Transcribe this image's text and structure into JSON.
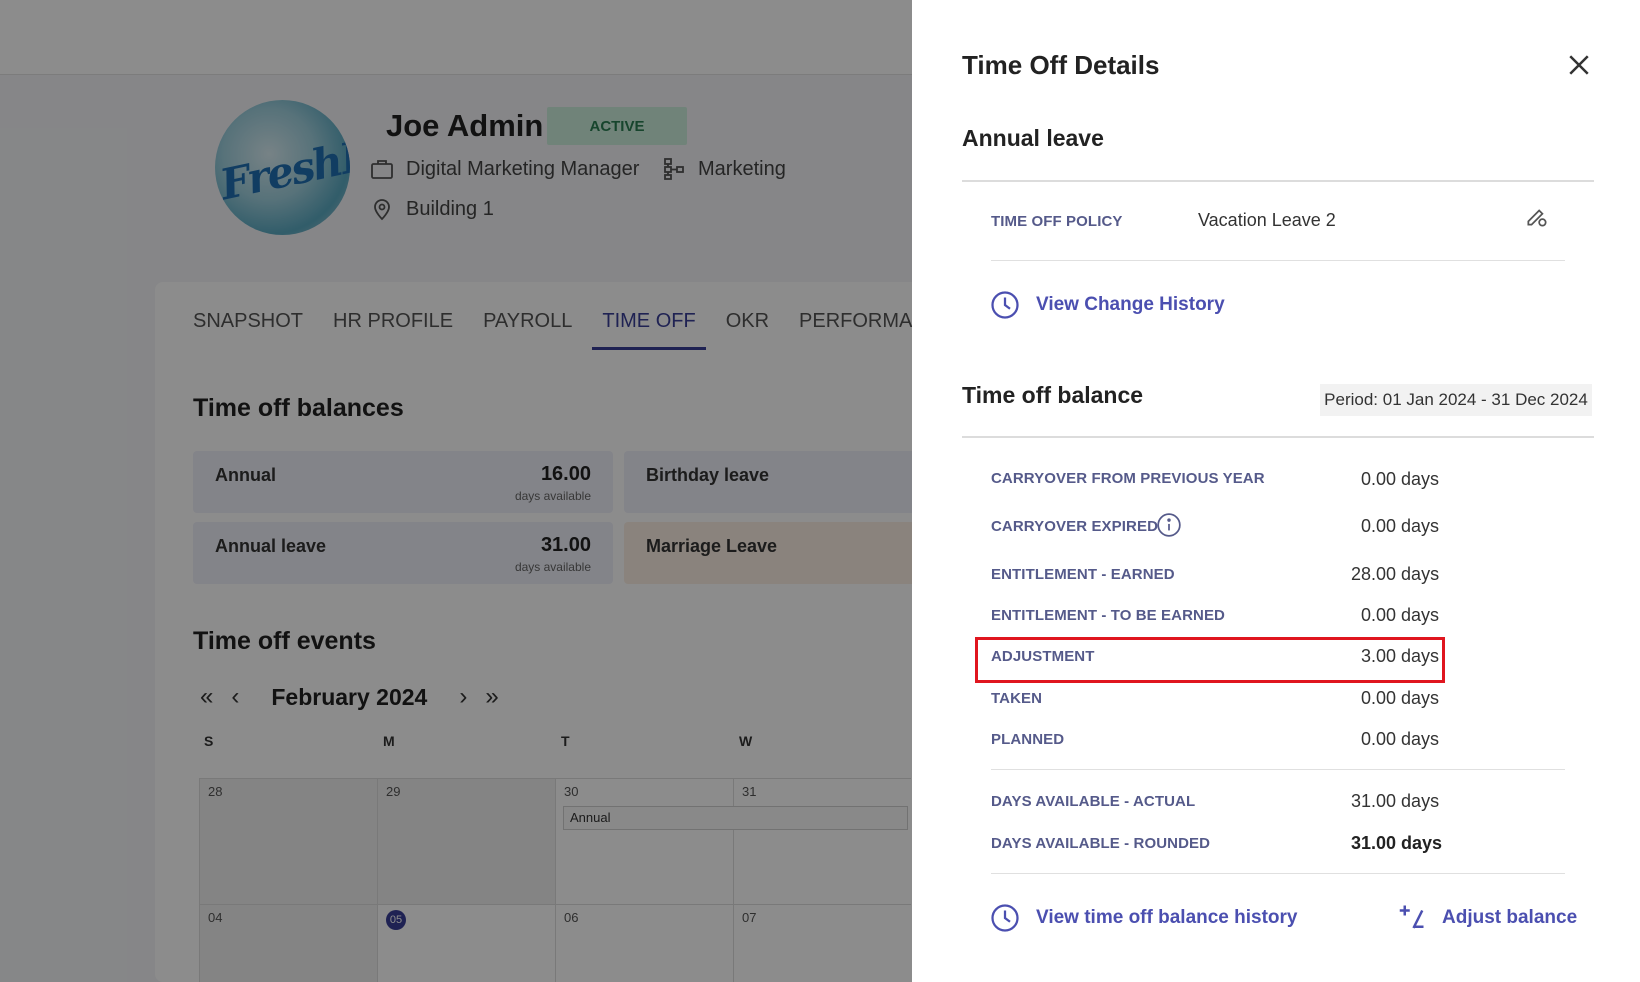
{
  "background": {
    "employee": {
      "name": "Joe Admin",
      "status": "ACTIVE",
      "job_title": "Digital Marketing Manager",
      "department": "Marketing",
      "location": "Building 1",
      "avatar_logo_text": "FreshBo"
    },
    "tabs": [
      "SNAPSHOT",
      "HR PROFILE",
      "PAYROLL",
      "TIME OFF",
      "OKR",
      "PERFORMANC"
    ],
    "active_tab": "TIME OFF",
    "balances_title": "Time off balances",
    "balances": [
      {
        "label": "Annual",
        "value": "16.00",
        "unit": "days available"
      },
      {
        "label": "Birthday leave"
      },
      {
        "label": "Annual leave",
        "value": "31.00",
        "unit": "days available"
      },
      {
        "label": "Marriage Leave"
      }
    ],
    "events_title": "Time off events",
    "calendar": {
      "month": "February 2024",
      "weekdays": [
        "S",
        "M",
        "T",
        "W"
      ],
      "row1": [
        "28",
        "29",
        "30",
        "31"
      ],
      "row2": [
        "04",
        "05",
        "06",
        "07"
      ],
      "event_label": "Annual"
    }
  },
  "panel": {
    "title": "Time Off Details",
    "leave_name": "Annual leave",
    "policy": {
      "label": "TIME OFF POLICY",
      "value": "Vacation Leave 2"
    },
    "view_change_history": "View Change History",
    "balance_title": "Time off balance",
    "period": "Period: 01 Jan 2024 - 31 Dec 2024",
    "rows": [
      {
        "label": "CARRYOVER FROM PREVIOUS YEAR",
        "value": "0.00 days"
      },
      {
        "label": "CARRYOVER EXPIRED",
        "value": "0.00 days"
      },
      {
        "label": "ENTITLEMENT - EARNED",
        "value": "28.00 days"
      },
      {
        "label": "ENTITLEMENT - TO BE EARNED",
        "value": "0.00 days"
      },
      {
        "label": "ADJUSTMENT",
        "value": "3.00 days"
      },
      {
        "label": "TAKEN",
        "value": "0.00 days"
      },
      {
        "label": "PLANNED",
        "value": "0.00 days"
      }
    ],
    "available": [
      {
        "label": "DAYS AVAILABLE - ACTUAL",
        "value": "31.00 days"
      },
      {
        "label": "DAYS AVAILABLE - ROUNDED",
        "value": "31.00 days"
      }
    ],
    "view_balance_history": "View time off balance history",
    "adjust_balance": "Adjust balance",
    "colors": {
      "accent": "#4b4fb0",
      "highlight": "#e0161f"
    }
  }
}
